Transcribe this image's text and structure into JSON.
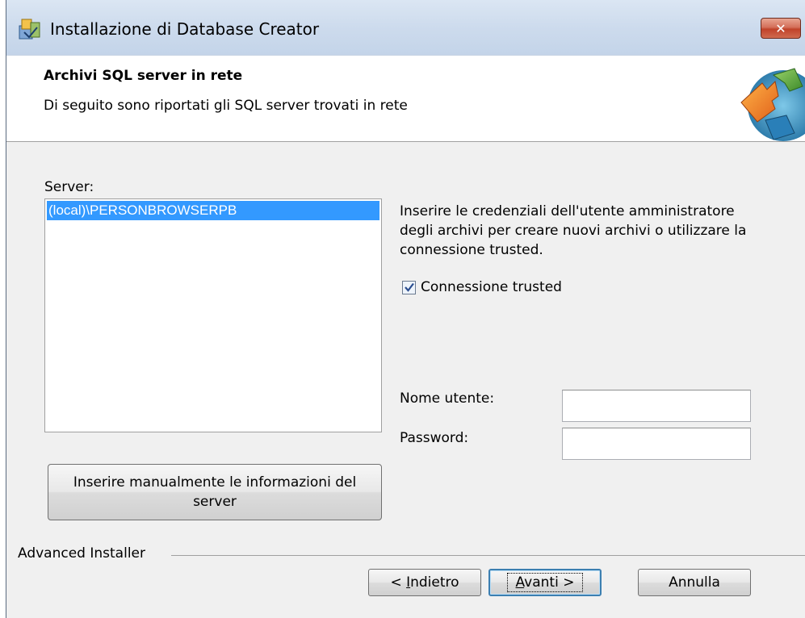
{
  "window": {
    "title": "Installazione di Database Creator",
    "close_label": "✕"
  },
  "header": {
    "title": "Archivi SQL server in rete",
    "subtitle": "Di seguito sono riportati gli SQL server trovati in rete"
  },
  "server_list": {
    "label": "Server:",
    "items": [
      "(local)\\PERSONBROWSERPB"
    ],
    "selected_index": 0
  },
  "manual_button": {
    "label": "Inserire manualmente le informazioni del server"
  },
  "credentials": {
    "instructions": "Inserire le credenziali dell'utente amministratore degli archivi per creare nuovi archivi o utilizzare la connessione trusted.",
    "trusted_label": "Connessione trusted",
    "trusted_checked": true,
    "username_label": "Nome utente:",
    "username_value": "",
    "password_label": "Password:",
    "password_value": ""
  },
  "footer": {
    "group_label": "Advanced Installer",
    "back_prefix": "< ",
    "back_accel": "I",
    "back_rest": "ndietro",
    "next_accel": "A",
    "next_rest": "vanti >",
    "cancel_label": "Annulla"
  },
  "colors": {
    "selection": "#3399ff",
    "close_button": "#c0422a",
    "dialog_bg": "#f0f0f0"
  }
}
